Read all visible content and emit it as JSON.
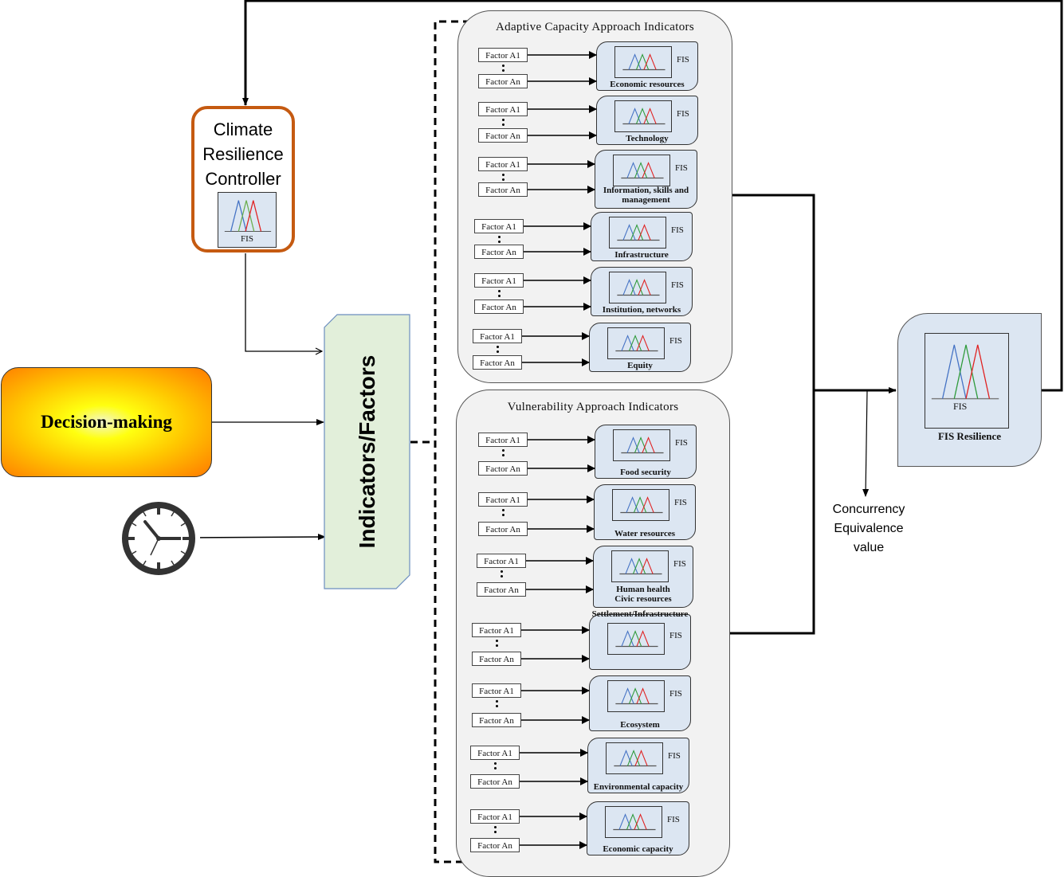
{
  "controller": {
    "title_lines": [
      "Climate",
      "Resilience",
      "Controller"
    ],
    "fis_label": "FIS",
    "border_color": "#c55a11"
  },
  "decision": {
    "label": "Decision-making"
  },
  "clock": {
    "icon": "clock-icon"
  },
  "indicators": {
    "label": "Indicators/Factors",
    "fill": "#e2efda"
  },
  "adaptive": {
    "title": "Adaptive Capacity Approach Indicators",
    "items": [
      {
        "factor_a1": "Factor A1",
        "factor_an": "Factor An",
        "fis": "FIS",
        "label": "Economic resources"
      },
      {
        "factor_a1": "Factor A1",
        "factor_an": "Factor An",
        "fis": "FIS",
        "label": "Technology"
      },
      {
        "factor_a1": "Factor A1",
        "factor_an": "Factor An",
        "fis": "FIS",
        "label": "Information, skills and management"
      },
      {
        "factor_a1": "Factor A1",
        "factor_an": "Factor An",
        "fis": "FIS",
        "label": "Infrastructure"
      },
      {
        "factor_a1": "Factor A1",
        "factor_an": "Factor An",
        "fis": "FIS",
        "label": "Institution, networks"
      },
      {
        "factor_a1": "Factor A1",
        "factor_an": "Factor An",
        "fis": "FIS",
        "label": "Equity"
      }
    ]
  },
  "vulnerability": {
    "title": "Vulnerability Approach Indicators",
    "items": [
      {
        "factor_a1": "Factor A1",
        "factor_an": "Factor An",
        "fis": "FIS",
        "label": "Food security"
      },
      {
        "factor_a1": "Factor A1",
        "factor_an": "Factor An",
        "fis": "FIS",
        "label": "Water resources"
      },
      {
        "factor_a1": "Factor A1",
        "factor_an": "Factor An",
        "fis": "FIS",
        "label": "Human health Civic resources"
      },
      {
        "factor_a1": "Factor A1",
        "factor_an": "Factor An",
        "fis": "FIS",
        "label": "Settlement/Infrastructure"
      },
      {
        "factor_a1": "Factor A1",
        "factor_an": "Factor An",
        "fis": "FIS",
        "label": "Ecosystem"
      },
      {
        "factor_a1": "Factor A1",
        "factor_an": "Factor An",
        "fis": "FIS",
        "label": "Environmental capacity"
      },
      {
        "factor_a1": "Factor A1",
        "factor_an": "Factor An",
        "fis": "FIS",
        "label": "Economic capacity"
      }
    ]
  },
  "resilience": {
    "fis_label": "FIS",
    "title": "FIS Resilience"
  },
  "concurrency": {
    "lines": [
      "Concurrency",
      "Equivalence",
      "value"
    ]
  },
  "colors": {
    "mf_blue": "#4472c4",
    "mf_green": "#2e9a3a",
    "mf_red": "#e02020",
    "card_fill": "#dce6f2",
    "panel_fill": "#f2f2f2"
  }
}
